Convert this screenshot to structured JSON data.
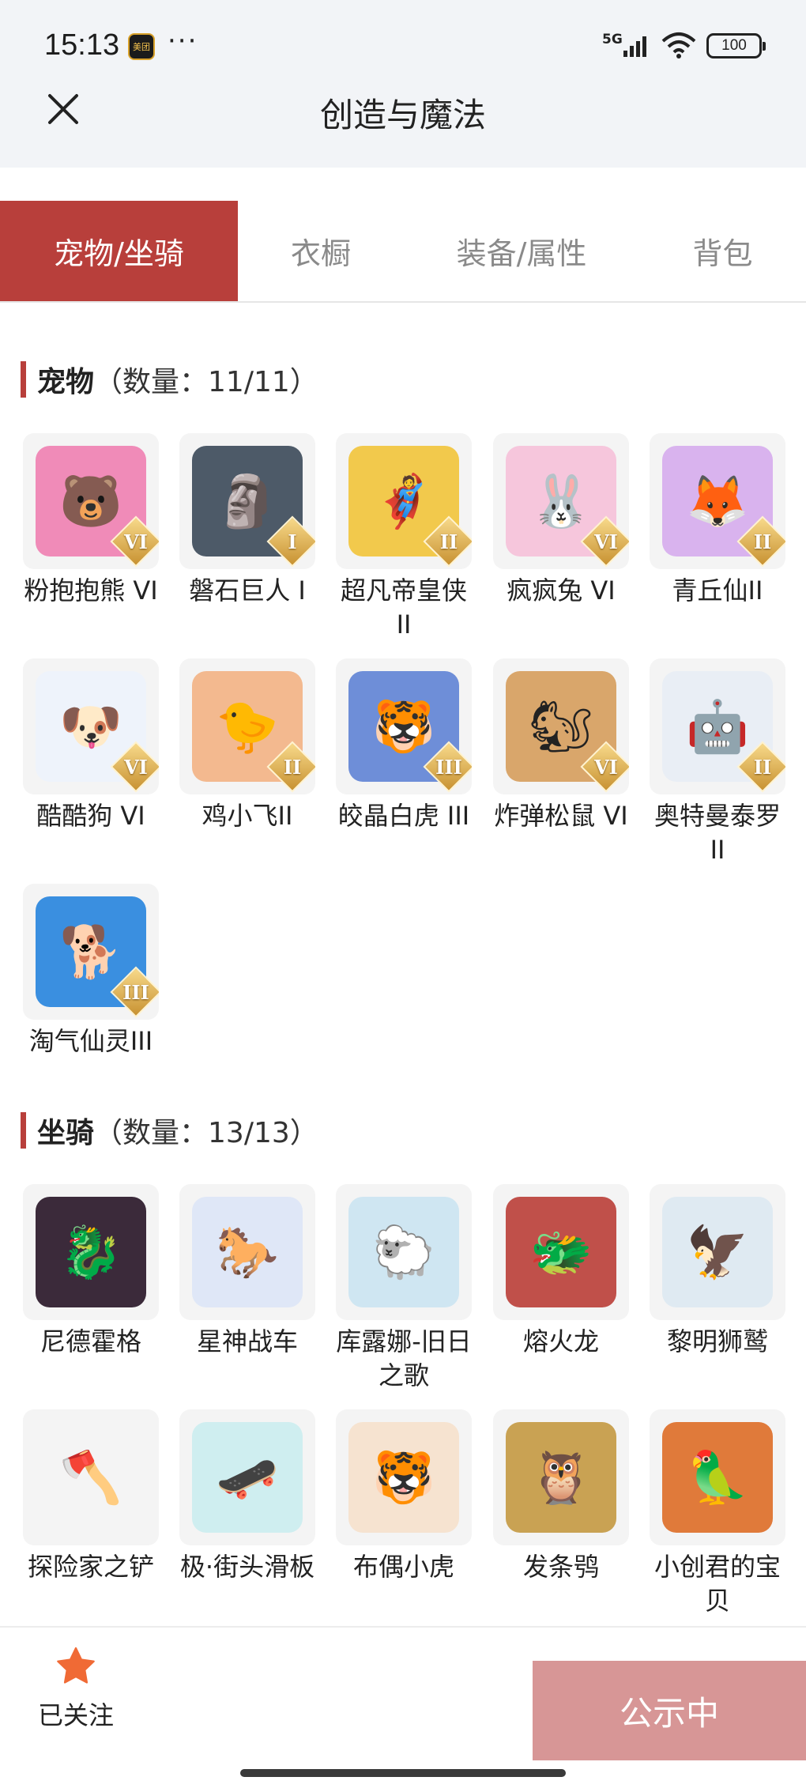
{
  "status_bar": {
    "time": "15:13",
    "app_badge": "美团",
    "more": "···",
    "network": "5G",
    "battery": "100"
  },
  "nav": {
    "title": "创造与魔法",
    "close_icon": "close-icon"
  },
  "tabs": [
    {
      "label": "宠物/坐骑",
      "active": true
    },
    {
      "label": "衣橱",
      "active": false
    },
    {
      "label": "装备/属性",
      "active": false
    },
    {
      "label": "背包",
      "active": false
    }
  ],
  "pets": {
    "title": "宠物",
    "count": "（数量：11/11）",
    "items": [
      {
        "name": "粉抱抱熊 VI",
        "tier": "VI",
        "color": "#f08bb8",
        "emoji": "🐻"
      },
      {
        "name": "磐石巨人 I",
        "tier": "I",
        "color": "#4d5a68",
        "emoji": "🗿"
      },
      {
        "name": "超凡帝皇侠 II",
        "tier": "II",
        "color": "#f2c94c",
        "emoji": "🦸"
      },
      {
        "name": "疯疯兔 VI",
        "tier": "VI",
        "color": "#f6c6dc",
        "emoji": "🐰"
      },
      {
        "name": "青丘仙II",
        "tier": "II",
        "color": "#d9b3ee",
        "emoji": "🦊"
      },
      {
        "name": "酷酷狗 VI",
        "tier": "VI",
        "color": "#eef3fb",
        "emoji": "🐶"
      },
      {
        "name": "鸡小飞II",
        "tier": "II",
        "color": "#f3b98f",
        "emoji": "🐤"
      },
      {
        "name": "皎晶白虎 III",
        "tier": "III",
        "color": "#6e8ed8",
        "emoji": "🐯"
      },
      {
        "name": "炸弹松鼠 VI",
        "tier": "VI",
        "color": "#d9a66b",
        "emoji": "🐿"
      },
      {
        "name": "奥特曼泰罗 II",
        "tier": "II",
        "color": "#e9eef5",
        "emoji": "🤖"
      },
      {
        "name": "淘气仙灵III",
        "tier": "III",
        "color": "#3a8fe0",
        "emoji": "🐕"
      }
    ]
  },
  "mounts": {
    "title": "坐骑",
    "count": "（数量：13/13）",
    "items": [
      {
        "name": "尼德霍格",
        "color": "#3b2a3a",
        "emoji": "🐉"
      },
      {
        "name": "星神战车",
        "color": "#dfe7f7",
        "emoji": "🐎"
      },
      {
        "name": "库露娜-旧日之歌",
        "color": "#cfe6f2",
        "emoji": "🐑"
      },
      {
        "name": "熔火龙",
        "color": "#c0504a",
        "emoji": "🐲"
      },
      {
        "name": "黎明狮鹫",
        "color": "#dfeaf2",
        "emoji": "🦅"
      },
      {
        "name": "探险家之铲",
        "color": "#f4f4f4",
        "emoji": "🪓"
      },
      {
        "name": "极·街头滑板",
        "color": "#cfeef0",
        "emoji": "🛹"
      },
      {
        "name": "布偶小虎",
        "color": "#f6e3d0",
        "emoji": "🐯"
      },
      {
        "name": "发条鸮",
        "color": "#c9a253",
        "emoji": "🦉"
      },
      {
        "name": "小创君的宝贝",
        "color": "#e07a3a",
        "emoji": "🦜"
      }
    ]
  },
  "bottom_bar": {
    "follow_label": "已关注",
    "public_label": "公示中"
  }
}
